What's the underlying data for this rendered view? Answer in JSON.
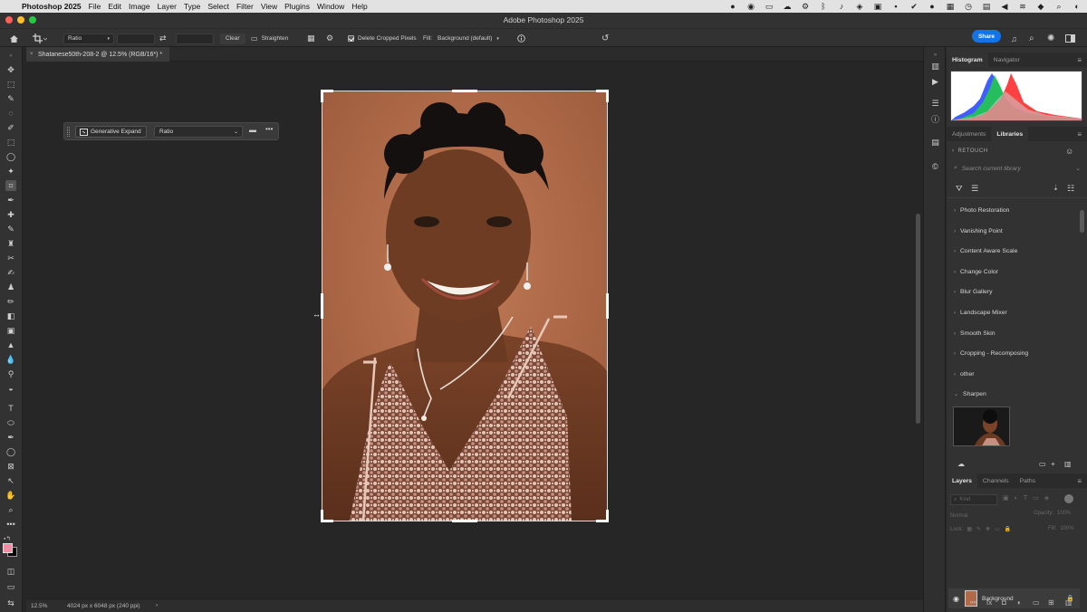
{
  "menubar": {
    "app_name": "Photoshop 2025",
    "items": [
      "File",
      "Edit",
      "Image",
      "Layer",
      "Type",
      "Select",
      "Filter",
      "View",
      "Plugins",
      "Window",
      "Help"
    ]
  },
  "window": {
    "title": "Adobe Photoshop 2025"
  },
  "options": {
    "ratio_select": "Ratio",
    "clear_label": "Clear",
    "straighten_label": "Straighten",
    "delete_cropped_label": "Delete Cropped Pixels",
    "fill_label": "Fill:",
    "fill_value": "Background (default)",
    "share_label": "Share"
  },
  "document": {
    "tab_title": "Shatanese50th-208-2 @ 12.5% (RGB/16*) *",
    "close_glyph": "×"
  },
  "genbar": {
    "button_label": "Generative Expand",
    "ratio_label": "Ratio"
  },
  "status": {
    "zoom": "12.5%",
    "doc_info": "4024 px x 6048 px (240 ppi)",
    "arrow": "›"
  },
  "panels": {
    "top_tabs": [
      "Histogram",
      "Navigator"
    ],
    "mid_tabs": [
      "Adjustments",
      "Libraries"
    ],
    "library_breadcrumb": "RETOUCH",
    "library_search_placeholder": "Search current library",
    "library_items": [
      "Photo Restoration",
      "Vanishing Point",
      "Content Aware Scale",
      "Change Color",
      "Blur Gallery",
      "Landscape Mixer",
      "Smooth Skin",
      "Cropping - Recomposing",
      "other",
      "Sharpen"
    ],
    "bottom_tabs": [
      "Layers",
      "Channels",
      "Paths"
    ],
    "layers_kind": "Kind",
    "layers_blend": "Normal",
    "layers_opacity_label": "Opacity:",
    "layers_opacity_value": "100%",
    "layers_lock_label": "Lock:",
    "layers_fill_label": "Fill:",
    "layers_fill_value": "100%",
    "layer_name": "Background"
  },
  "colors": {
    "accent": "#1473e6",
    "foreground_swatch": "#f08ea4",
    "background_swatch": "#000000"
  }
}
